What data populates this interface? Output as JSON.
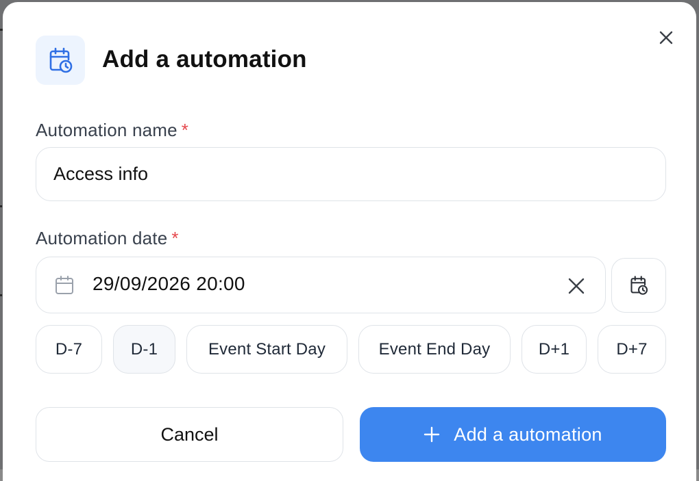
{
  "modal": {
    "title": "Add a automation",
    "header_icon": "calendar-clock-icon",
    "close_icon": "close-icon"
  },
  "name_field": {
    "label": "Automation name",
    "required_mark": "*",
    "value": "Access info"
  },
  "date_field": {
    "label": "Automation date",
    "required_mark": "*",
    "value": "29/09/2026 20:00",
    "leading_icon": "calendar-icon",
    "clear_icon": "clear-icon",
    "schedule_icon": "calendar-clock-icon"
  },
  "shortcuts": [
    {
      "label": "D-7",
      "selected": false
    },
    {
      "label": "D-1",
      "selected": true
    },
    {
      "label": "Event Start Day",
      "selected": false
    },
    {
      "label": "Event End Day",
      "selected": false
    },
    {
      "label": "D+1",
      "selected": false
    },
    {
      "label": "D+7",
      "selected": false
    }
  ],
  "actions": {
    "cancel_label": "Cancel",
    "submit_label": "Add a automation",
    "submit_icon": "plus-icon"
  },
  "colors": {
    "accent": "#3d86ef",
    "required": "#e5484d",
    "icon_bg": "#edf4fe"
  }
}
